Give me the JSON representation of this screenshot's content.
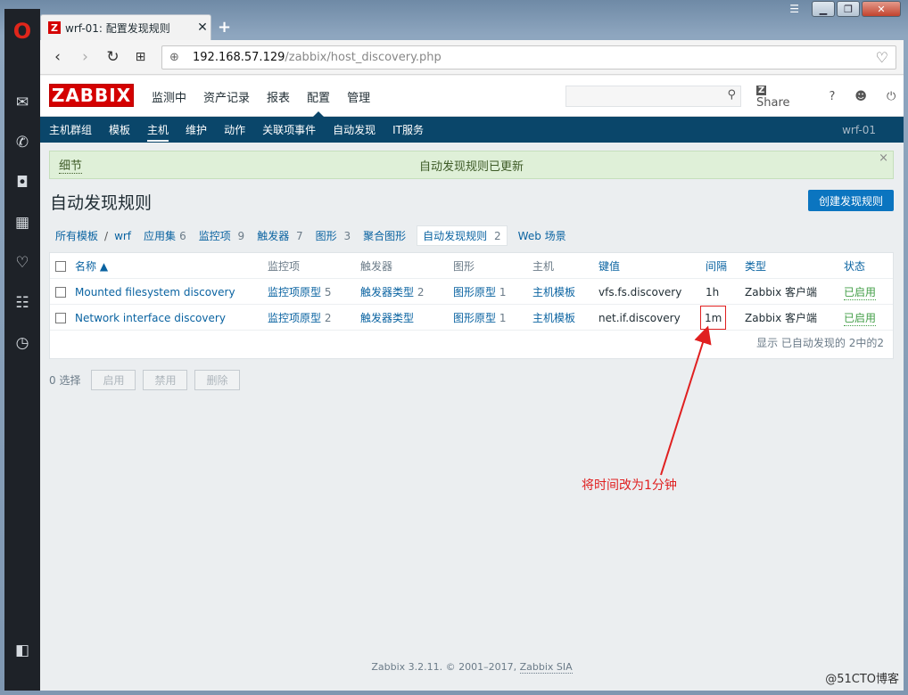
{
  "browser": {
    "tab_title": "wrf-01: 配置发现规则",
    "tab_favicon": "Z",
    "url_host": "192.168.57.129",
    "url_path": "/zabbix/host_discovery.php"
  },
  "zabbix": {
    "logo": "ZABBIX",
    "main_menu": [
      "监测中",
      "资产记录",
      "报表",
      "配置",
      "管理"
    ],
    "active_main": "配置",
    "share": "Share",
    "help": "?",
    "sub_menu": [
      "主机群组",
      "模板",
      "主机",
      "维护",
      "动作",
      "关联项事件",
      "自动发现",
      "IT服务"
    ],
    "active_sub": "主机",
    "server_name": "wrf-01",
    "message": {
      "details": "细节",
      "text": "自动发现规则已更新",
      "close": "×"
    },
    "page_title": "自动发现规则",
    "create_button": "创建发现规则",
    "breadcrumbs": {
      "all_templates": "所有模板",
      "slash": "/",
      "template": "wrf",
      "apps": "应用集",
      "apps_count": "6",
      "items": "监控项",
      "items_count": "9",
      "triggers": "触发器",
      "triggers_count": "7",
      "graphs": "图形",
      "graphs_count": "3",
      "screens": "聚合图形",
      "discovery": "自动发现规则",
      "discovery_count": "2",
      "web": "Web 场景"
    },
    "table": {
      "headers": {
        "name": "名称 ▲",
        "items": "监控项",
        "triggers": "触发器",
        "graphs": "图形",
        "hosts": "主机",
        "key": "键值",
        "interval": "间隔",
        "type": "类型",
        "status": "状态"
      },
      "rows": [
        {
          "name": "Mounted filesystem discovery",
          "items": "监控项原型",
          "items_count": "5",
          "triggers": "触发器类型",
          "triggers_count": "2",
          "graphs": "图形原型",
          "graphs_count": "1",
          "hosts": "主机模板",
          "key": "vfs.fs.discovery",
          "interval": "1h",
          "type": "Zabbix 客户端",
          "status": "已启用"
        },
        {
          "name": "Network interface discovery",
          "items": "监控项原型",
          "items_count": "2",
          "triggers": "触发器类型",
          "triggers_count": "",
          "graphs": "图形原型",
          "graphs_count": "1",
          "hosts": "主机模板",
          "key": "net.if.discovery",
          "interval": "1m",
          "type": "Zabbix 客户端",
          "status": "已启用"
        }
      ],
      "footer": "显示 已自动发现的 2中的2"
    },
    "actions": {
      "selected": "0 选择",
      "enable": "启用",
      "disable": "禁用",
      "delete": "删除"
    },
    "annotation": "将时间改为1分钟",
    "footer": {
      "text": "Zabbix 3.2.11. © 2001–2017, ",
      "company": "Zabbix SIA"
    }
  },
  "watermark": "@51CTO博客",
  "colors": {
    "zabbix_red": "#d40000",
    "nav_blue": "#0a466a",
    "link": "#0a63a1",
    "success_bg": "#dff0d8",
    "annotation": "#e02020",
    "enabled": "#429e47"
  }
}
